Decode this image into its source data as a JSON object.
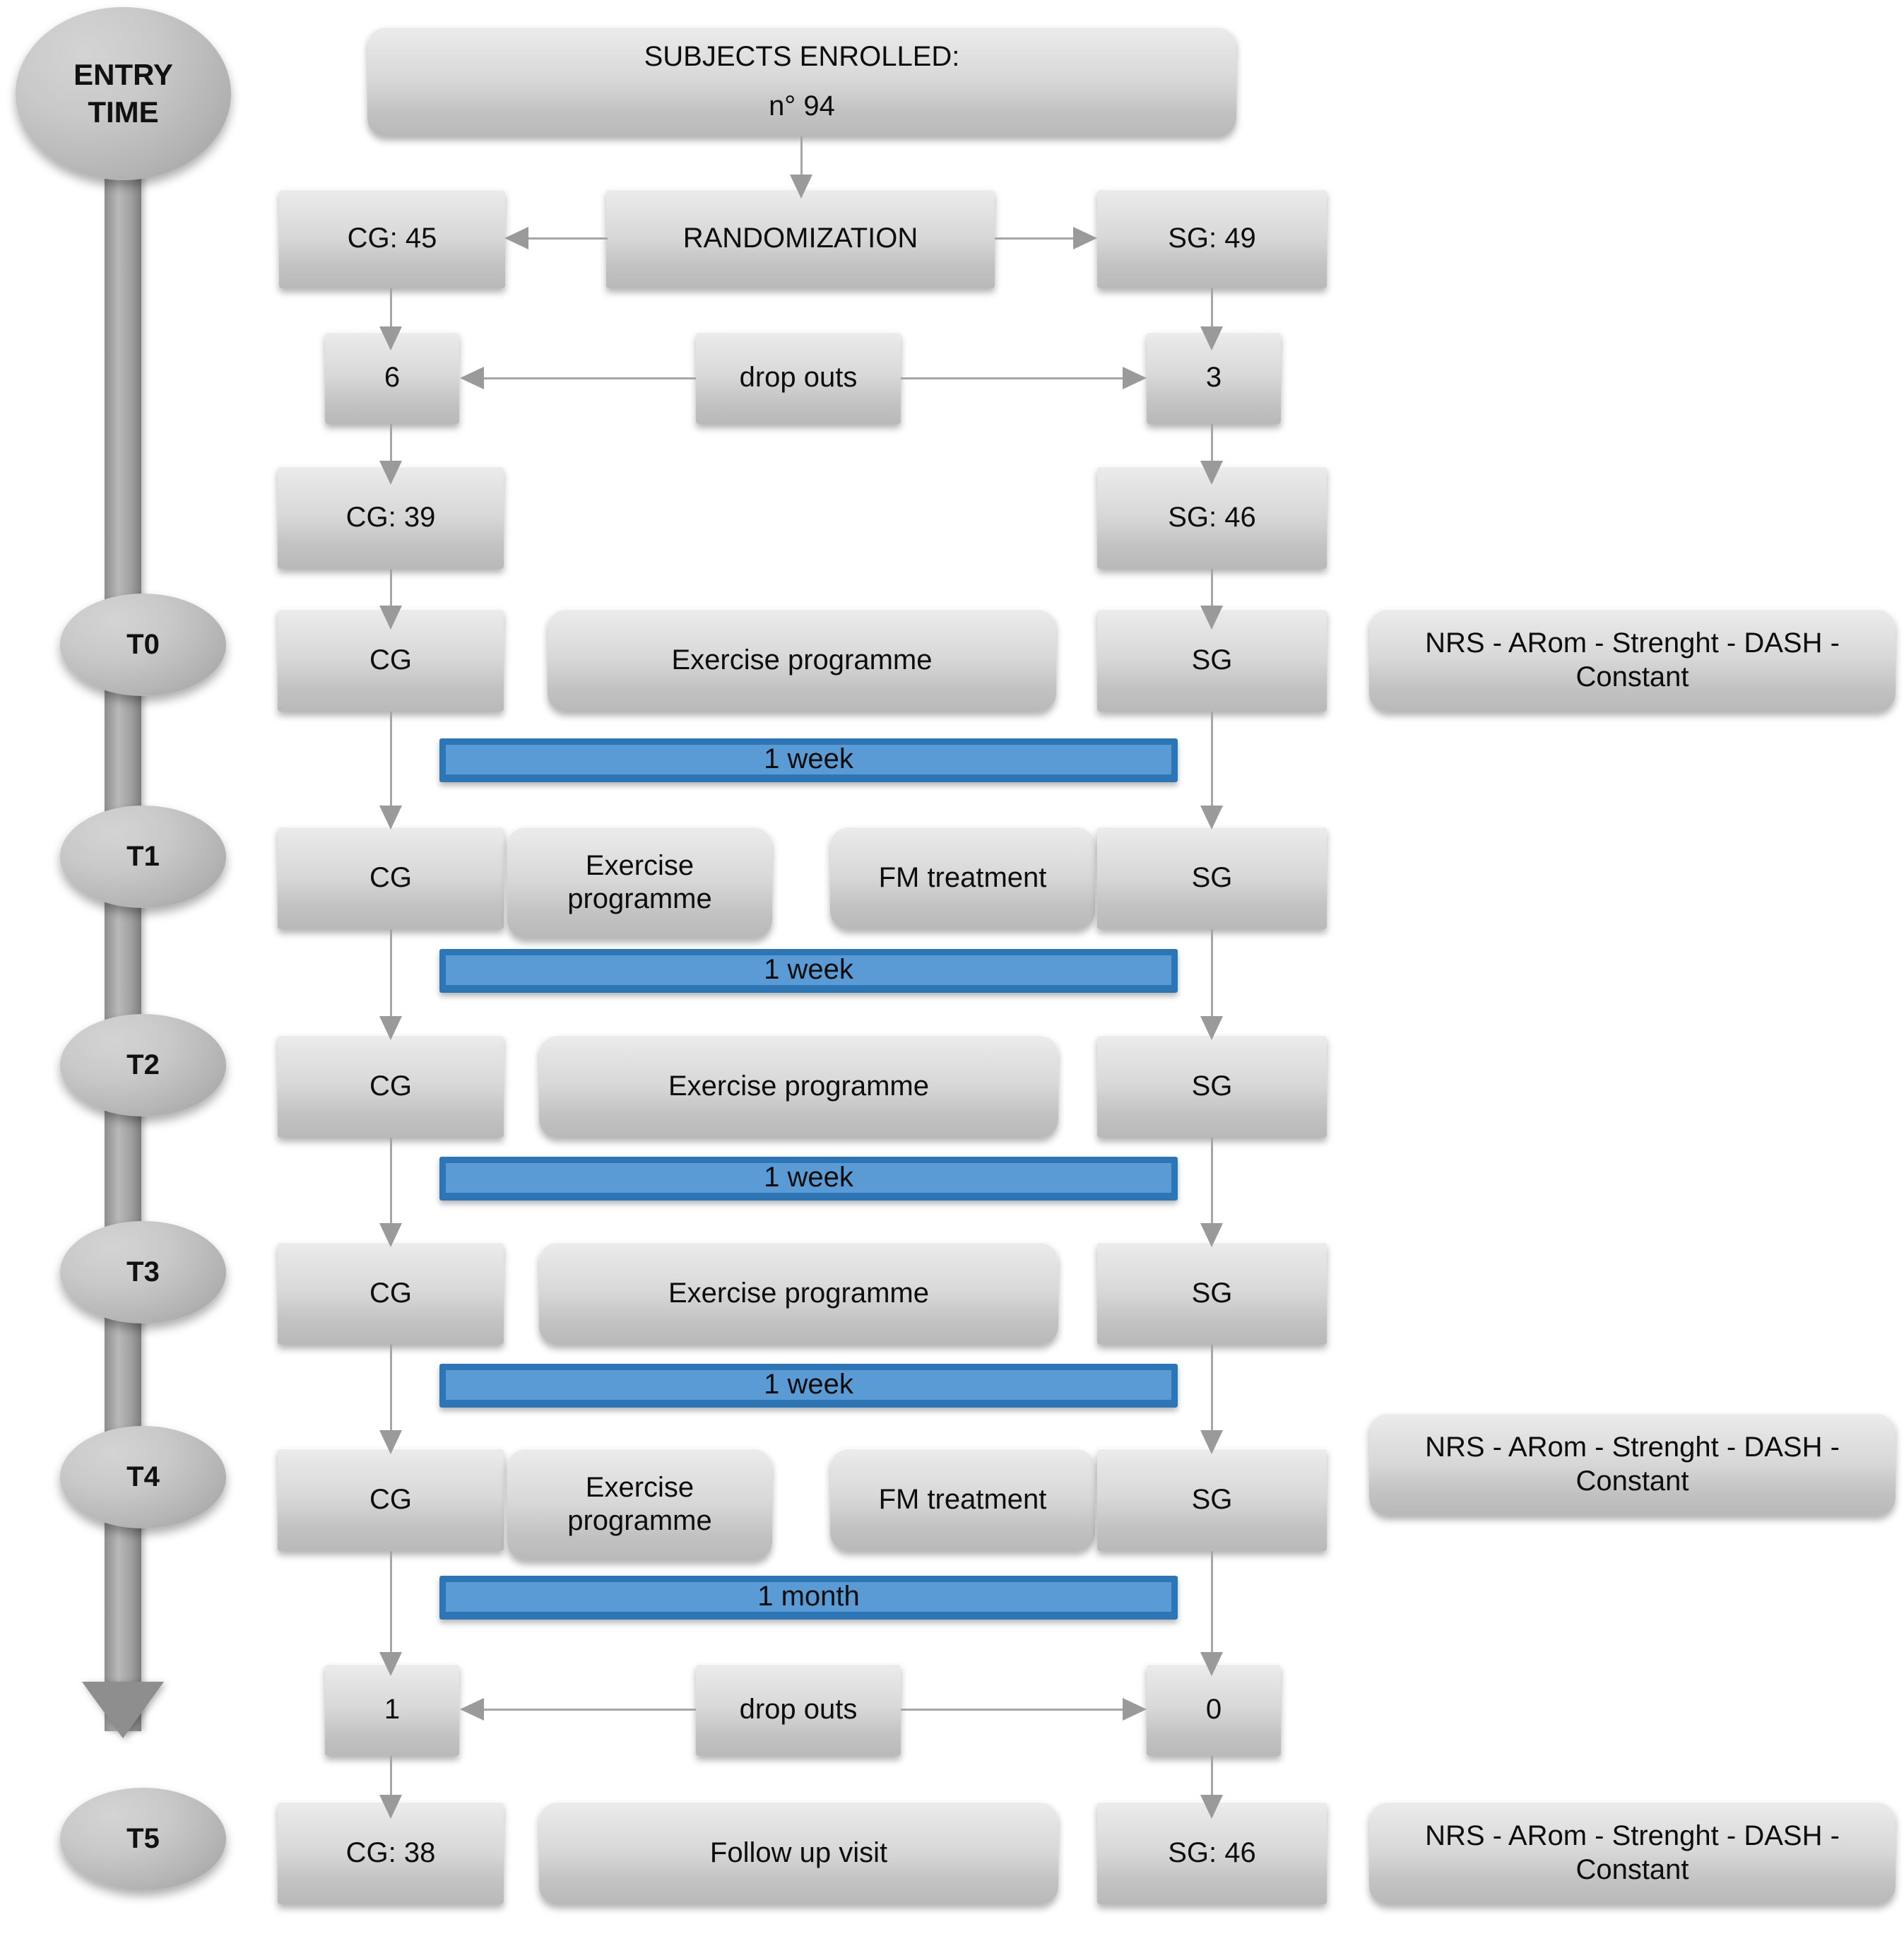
{
  "figure": {
    "type": "clinical-trial-flow-diagram",
    "accent_blue": "#5B9BD5",
    "accent_blue_border": "#2E75B6",
    "node_grey": "#D8D8D8",
    "connector_grey": "#A6A6A6"
  },
  "timeline": {
    "label": "ENTRY\nTIME",
    "points": [
      {
        "id": "t0",
        "label": "T0"
      },
      {
        "id": "t1",
        "label": "T1"
      },
      {
        "id": "t2",
        "label": "T2"
      },
      {
        "id": "t3",
        "label": "T3"
      },
      {
        "id": "t4",
        "label": "T4"
      },
      {
        "id": "t5",
        "label": "T5"
      }
    ]
  },
  "enrollment": {
    "title": "SUBJECTS ENROLLED:",
    "count": "n° 94",
    "randomization": "RANDOMIZATION",
    "control_initial": "CG: 45",
    "study_initial": "SG: 49"
  },
  "dropouts_first": {
    "label": "drop outs",
    "control": "6",
    "study": "3"
  },
  "after_dropouts_first": {
    "control": "CG: 39",
    "study": "SG: 46"
  },
  "rows": {
    "t0": {
      "control": "CG",
      "middle": "Exercise programme",
      "study": "SG",
      "assessment": "NRS - ARom - Strenght - DASH - Constant"
    },
    "t1": {
      "control": "CG",
      "control_extra": "Exercise programme",
      "middle": "FM treatment",
      "study": "SG"
    },
    "t2": {
      "control": "CG",
      "middle": "Exercise programme",
      "study": "SG"
    },
    "t3": {
      "control": "CG",
      "middle": "Exercise programme",
      "study": "SG"
    },
    "t4": {
      "control": "CG",
      "control_extra": "Exercise programme",
      "middle": "FM treatment",
      "study": "SG",
      "assessment": "NRS - ARom - Strenght - DASH - Constant"
    },
    "t5": {
      "control": "CG: 38",
      "middle": "Follow up visit",
      "study": "SG: 46",
      "assessment": "NRS - ARom - Strenght - DASH - Constant"
    }
  },
  "intervals": {
    "t0_t1": "1 week",
    "t1_t2": "1 week",
    "t2_t3": "1 week",
    "t3_t4": "1 week",
    "t4_t5": "1 month"
  },
  "dropouts_second": {
    "label": "drop outs",
    "control": "1",
    "study": "0"
  }
}
